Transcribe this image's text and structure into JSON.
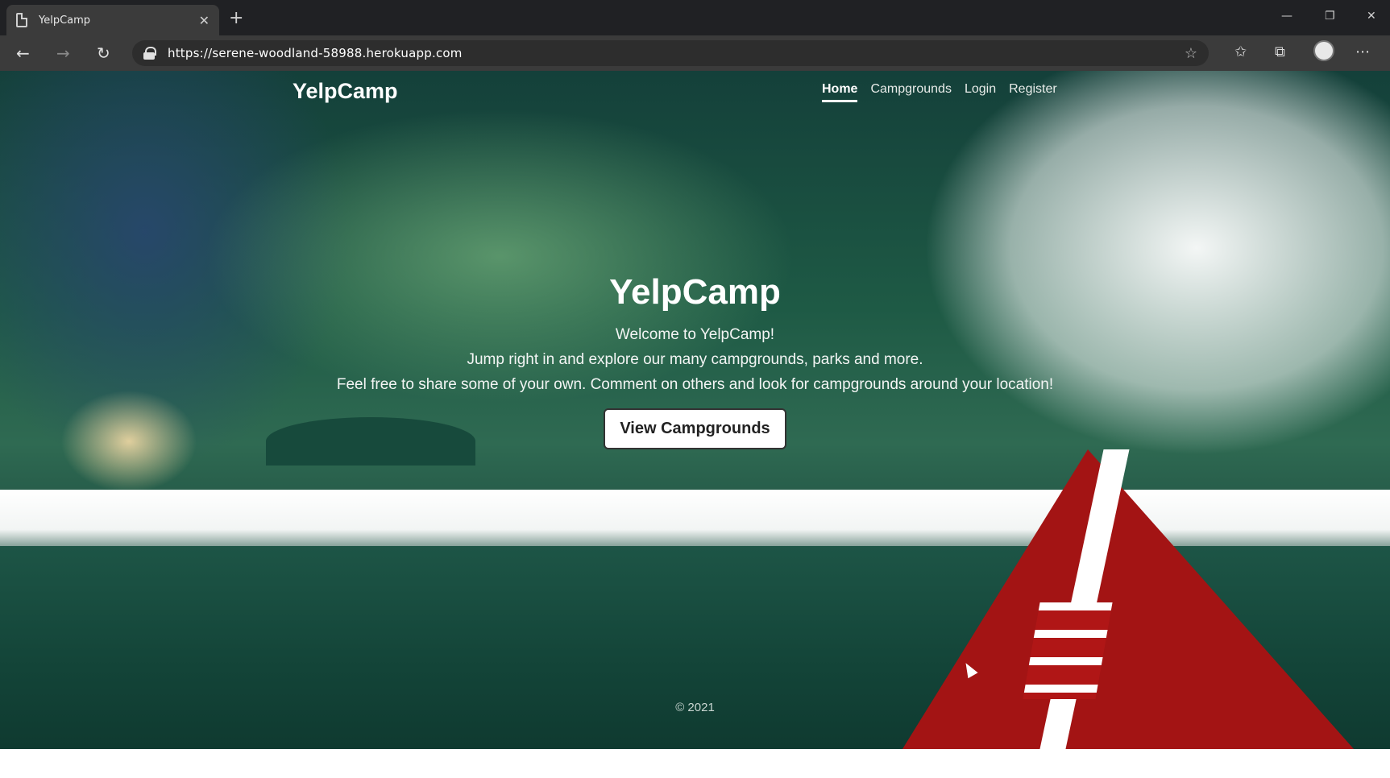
{
  "browser": {
    "tab_title": "YelpCamp",
    "tab_close": "✕",
    "new_tab": "+",
    "url": "https://serene-woodland-58988.herokuapp.com",
    "icons": [
      "page-icon",
      "back-icon",
      "forward-icon",
      "refresh-icon",
      "lock-icon",
      "star-icon",
      "favorites-icon",
      "collections-icon",
      "profile-icon",
      "more-icon"
    ],
    "win_controls": {
      "minimize": "—",
      "maximize": "❐",
      "close": "✕"
    },
    "nav_glyphs": {
      "back": "←",
      "forward": "→",
      "refresh": "↻",
      "star": "☆",
      "favorites": "✩",
      "collections": "⧉",
      "more": "⋯"
    }
  },
  "site": {
    "brand": "YelpCamp",
    "nav": {
      "home": "Home",
      "campgrounds": "Campgrounds",
      "login": "Login",
      "register": "Register"
    },
    "hero": {
      "title": "YelpCamp",
      "line1": "Welcome to YelpCamp!",
      "line2": "Jump right in and explore our many campgrounds, parks and more.",
      "line3": "Feel free to share some of your own. Comment on others and look for campgrounds around your location!",
      "cta": "View Campgrounds"
    },
    "footer": "© 2021"
  },
  "colors": {
    "chrome_dark": "#202124",
    "chrome_toolbar": "#3b3b3b",
    "tent_red": "#a31414",
    "forest_green": "#1d5546"
  }
}
